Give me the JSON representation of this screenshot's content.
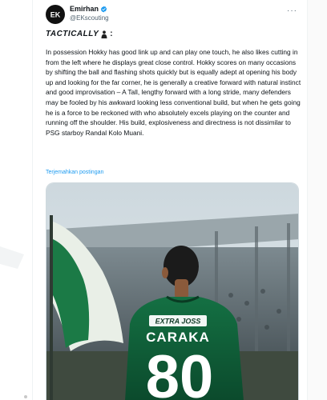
{
  "tweet": {
    "display_name": "Emirhan",
    "handle": "@EKscouting",
    "more_label": "···",
    "heading": "TACTICALLY",
    "heading_suffix": ":",
    "body": "In possession Hokky has good link up and can play one touch, he also likes cutting in from the left where he displays great close control. Hokky scores on many occasions by shifting the ball and flashing shots quickly but is equally adept at opening his body up and looking for the far corner, he is generally a creative forward with natural instinct and good improvisation – A Tall, lengthy forward with a long stride, many defenders may be fooled by his awkward looking less conventional build, but when he gets going he is a force to be reckoned with who absolutely excels playing on the counter and running off the shoulder. His build, explosiveness and directness is not dissimilar to PSG starboy Randal Kolo Muani.",
    "translate_label": "Terjemahkan postingan"
  },
  "photo": {
    "sponsor": "EXTRA JOSS",
    "player_name": "CARAKA",
    "number": "80"
  },
  "icons": {
    "avatar": "ek-logo-icon",
    "verified": "verified-badge-icon",
    "more": "more-icon",
    "heading": "person-silhouette-icon"
  },
  "colors": {
    "accent": "#1d9bf0",
    "jersey": "#0f5a36",
    "text": "#0f1419",
    "muted": "#536471"
  }
}
